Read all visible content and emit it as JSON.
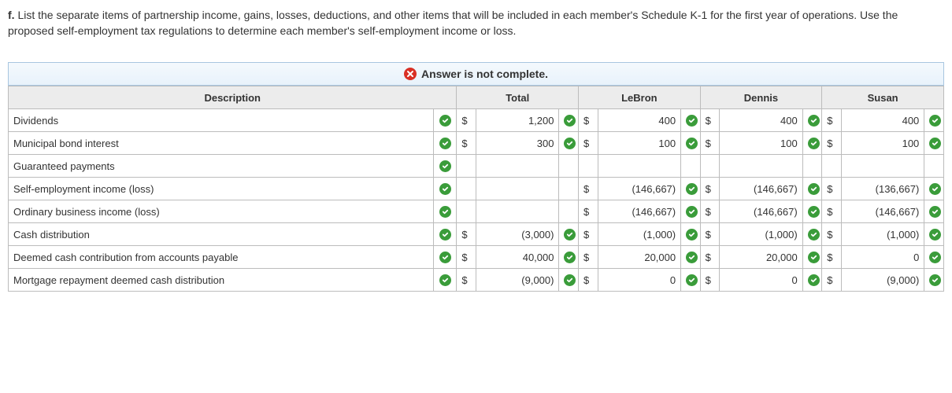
{
  "question_prefix": "f.",
  "question_text": "List the separate items of partnership income, gains, losses, deductions, and other items that will be included in each member's Schedule K-1 for the first year of operations. Use the proposed self-employment tax regulations to determine each member's self-employment income or loss.",
  "banner": "Answer is not complete.",
  "headers": {
    "description": "Description",
    "total": "Total",
    "c1": "LeBron",
    "c2": "Dennis",
    "c3": "Susan"
  },
  "rows": [
    {
      "desc": "Dividends",
      "total_cur": "$",
      "total_val": "1,200",
      "a_cur": "$",
      "a_val": "400",
      "b_cur": "$",
      "b_val": "400",
      "c_cur": "$",
      "c_val": "400"
    },
    {
      "desc": "Municipal bond interest",
      "total_cur": "$",
      "total_val": "300",
      "a_cur": "$",
      "a_val": "100",
      "b_cur": "$",
      "b_val": "100",
      "c_cur": "$",
      "c_val": "100"
    },
    {
      "desc": "Guaranteed payments",
      "total_cur": "",
      "total_val": "",
      "a_cur": "",
      "a_val": "",
      "b_cur": "",
      "b_val": "",
      "c_cur": "",
      "c_val": ""
    },
    {
      "desc": "Self-employment income (loss)",
      "total_cur": "",
      "total_val": "",
      "a_cur": "$",
      "a_val": "(146,667)",
      "b_cur": "$",
      "b_val": "(146,667)",
      "c_cur": "$",
      "c_val": "(136,667)"
    },
    {
      "desc": "Ordinary business income (loss)",
      "total_cur": "",
      "total_val": "",
      "a_cur": "$",
      "a_val": "(146,667)",
      "b_cur": "$",
      "b_val": "(146,667)",
      "c_cur": "$",
      "c_val": "(146,667)"
    },
    {
      "desc": "Cash distribution",
      "total_cur": "$",
      "total_val": "(3,000)",
      "a_cur": "$",
      "a_val": "(1,000)",
      "b_cur": "$",
      "b_val": "(1,000)",
      "c_cur": "$",
      "c_val": "(1,000)"
    },
    {
      "desc": "Deemed cash contribution from accounts payable",
      "total_cur": "$",
      "total_val": "40,000",
      "a_cur": "$",
      "a_val": "20,000",
      "b_cur": "$",
      "b_val": "20,000",
      "c_cur": "$",
      "c_val": "0"
    },
    {
      "desc": "Mortgage repayment deemed cash distribution",
      "total_cur": "$",
      "total_val": "(9,000)",
      "a_cur": "$",
      "a_val": "0",
      "b_cur": "$",
      "b_val": "0",
      "c_cur": "$",
      "c_val": "(9,000)"
    }
  ]
}
